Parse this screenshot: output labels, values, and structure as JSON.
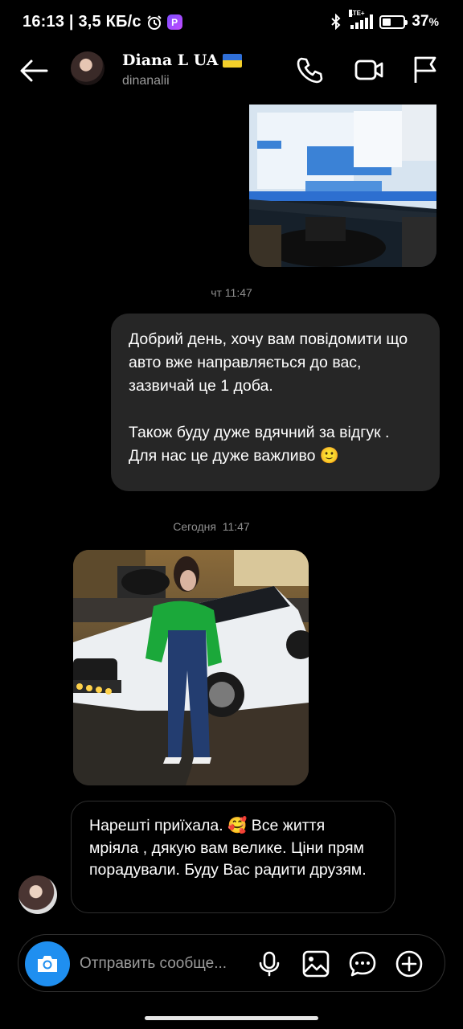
{
  "status_bar": {
    "time_speed": "16:13 | 3,5 КБ/с",
    "app_badge": "P",
    "network": "LTE+",
    "battery": "37",
    "battery_unit": "%",
    "battery_level": 0.37
  },
  "header": {
    "name": "Diana L UA",
    "username": "dinanalii",
    "icons": [
      "back-arrow-icon",
      "phone-icon",
      "video-camera-icon",
      "flag-icon"
    ]
  },
  "chat": {
    "timestamps": [
      {
        "day": "чт",
        "time": "11:47"
      },
      {
        "day": "Сегодня",
        "time": "11:47"
      }
    ],
    "outgoing": {
      "text": "Добрий день, хочу вам повідомити що авто вже направляється до вас, зазвичай це 1 доба.\n\nТакож буду дуже вдячний за відгук . Для нас це дуже важливо 🙂"
    },
    "incoming": {
      "text": "Нарешті приїхала. 🥰 Все життя мріяла , дякую вам велике. Ціни прям порадували. Буду Вас радити друзям."
    }
  },
  "composer": {
    "placeholder": "Отправить сообще...",
    "icons": [
      "camera-icon",
      "microphone-icon",
      "gallery-icon",
      "sticker-icon",
      "plus-icon"
    ]
  },
  "colors": {
    "background": "#000000",
    "bubble": "#262626",
    "accent": "#1f8ff0",
    "muted": "#8e8e8e"
  }
}
